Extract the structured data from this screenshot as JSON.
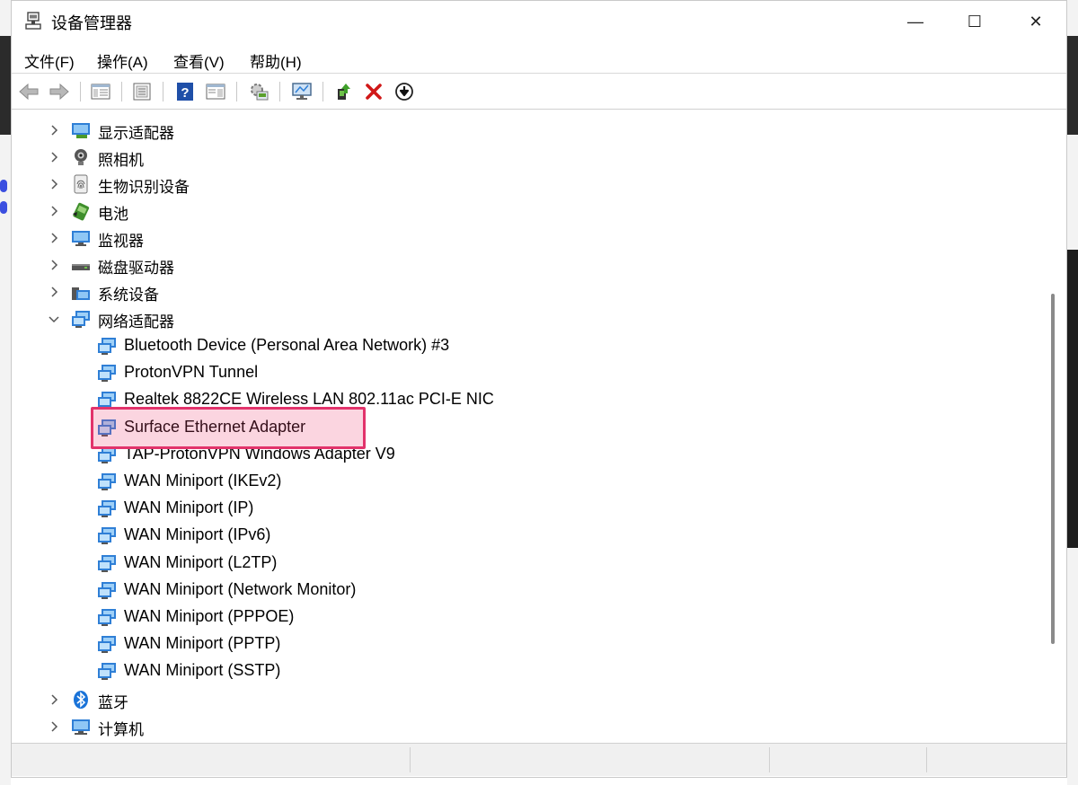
{
  "window": {
    "title": "设备管理器",
    "minimize": "—",
    "maximize": "☐",
    "close": "✕"
  },
  "menu": [
    "文件(F)",
    "操作(A)",
    "查看(V)",
    "帮助(H)"
  ],
  "toolbar": {
    "buttons": [
      "back-arrow-icon",
      "forward-arrow-icon",
      "show-hide-tree-icon",
      "properties-icon",
      "help-icon",
      "action-pane-icon",
      "scan-hardware-icon",
      "monitor-icon",
      "update-driver-icon",
      "uninstall-icon",
      "disable-device-icon"
    ]
  },
  "tree": {
    "categories_top": [
      {
        "label": "显示适配器",
        "icon": "display-adapter-icon"
      },
      {
        "label": "照相机",
        "icon": "camera-icon"
      },
      {
        "label": "生物识别设备",
        "icon": "biometric-icon"
      },
      {
        "label": "电池",
        "icon": "battery-icon"
      },
      {
        "label": "监视器",
        "icon": "monitor-icon"
      },
      {
        "label": "磁盘驱动器",
        "icon": "disk-drive-icon"
      },
      {
        "label": "系统设备",
        "icon": "system-device-icon"
      }
    ],
    "network": {
      "label": "网络适配器",
      "expanded": true,
      "children": [
        "Bluetooth Device (Personal Area Network) #3",
        "ProtonVPN Tunnel",
        "Realtek 8822CE Wireless LAN 802.11ac PCI-E NIC",
        "Surface Ethernet Adapter",
        "TAP-ProtonVPN Windows Adapter V9",
        "WAN Miniport (IKEv2)",
        "WAN Miniport (IP)",
        "WAN Miniport (IPv6)",
        "WAN Miniport (L2TP)",
        "WAN Miniport (Network Monitor)",
        "WAN Miniport (PPPOE)",
        "WAN Miniport (PPTP)",
        "WAN Miniport (SSTP)"
      ],
      "highlighted": "Surface Ethernet Adapter"
    },
    "categories_bottom": [
      {
        "label": "蓝牙",
        "icon": "bluetooth-icon"
      },
      {
        "label": "计算机",
        "icon": "computer-icon"
      }
    ]
  },
  "colors": {
    "highlight_border": "#e2336b",
    "network_icon": "#2f7fd6",
    "uninstall_red": "#d01818"
  }
}
